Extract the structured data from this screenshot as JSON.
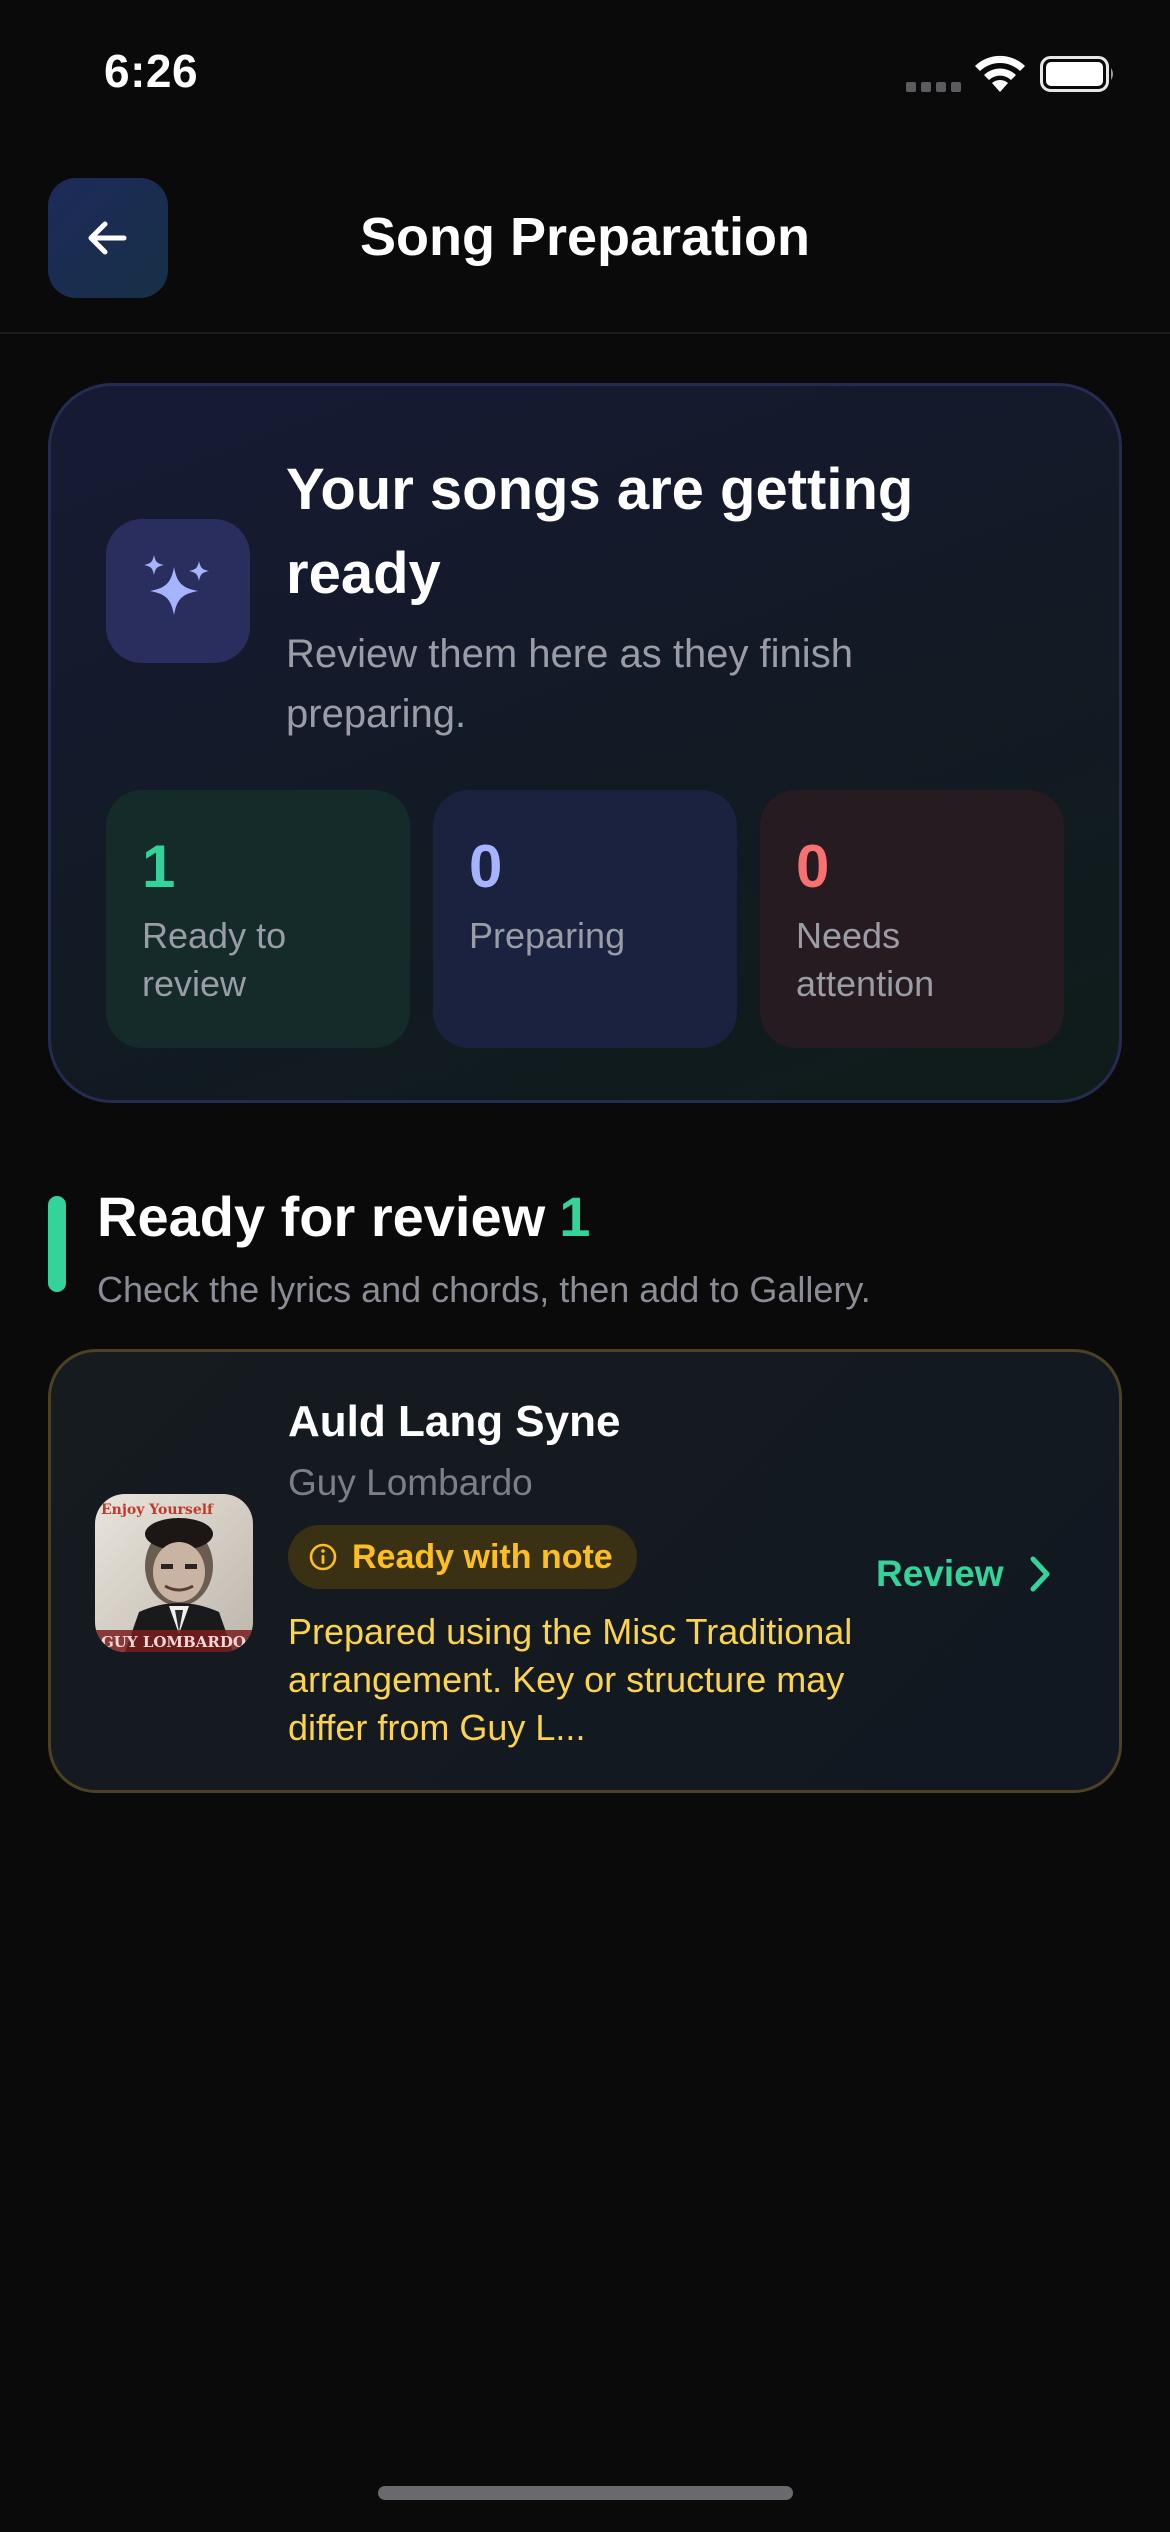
{
  "status_bar": {
    "time": "6:26"
  },
  "nav": {
    "title": "Song Preparation"
  },
  "hero": {
    "title": "Your songs are getting ready",
    "subtitle": "Review them here as they finish preparing.",
    "stats": [
      {
        "value": "1",
        "label": "Ready to review"
      },
      {
        "value": "0",
        "label": "Preparing"
      },
      {
        "value": "0",
        "label": "Needs attention"
      }
    ]
  },
  "section": {
    "title": "Ready for review",
    "count": "1",
    "subtitle": "Check the lyrics and chords, then add to Gallery."
  },
  "songs": [
    {
      "title": "Auld Lang Syne",
      "artist": "Guy Lombardo",
      "badge": "Ready with note",
      "note": "Prepared using the Misc Traditional arrangement. Key or structure may differ from Guy L...",
      "action": "Review",
      "artwork_text_top": "Enjoy Yourself",
      "artwork_text_bottom": "GUY LOMBARDO"
    }
  ],
  "colors": {
    "accent_green": "#34d399",
    "accent_blue": "#a5b4fc",
    "accent_red": "#f87171",
    "warning_yellow": "#fbbf24",
    "background": "#0a0a0b"
  },
  "icons": {
    "back": "arrow-left-icon",
    "hero": "sparkles-icon",
    "badge": "info-circle-icon",
    "review": "chevron-right-icon"
  }
}
